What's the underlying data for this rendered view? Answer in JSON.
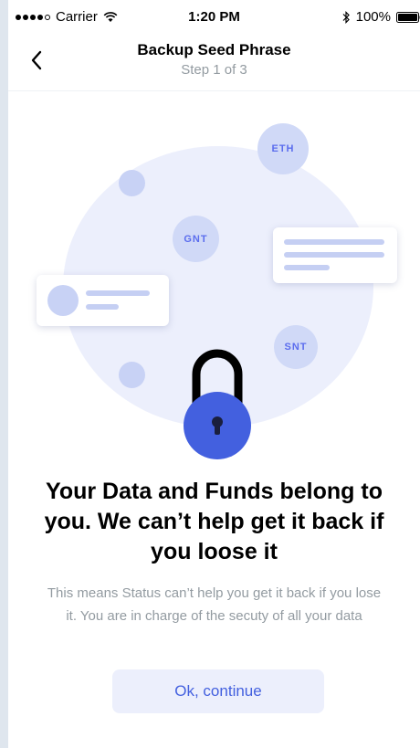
{
  "status_bar": {
    "carrier": "Carrier",
    "time": "1:20 PM",
    "battery_percent": "100%"
  },
  "header": {
    "title": "Backup Seed Phrase",
    "subtitle": "Step 1 of 3",
    "back_icon": "chevron-left-icon"
  },
  "illustration": {
    "tokens": [
      "ETH",
      "GNT",
      "SNT"
    ],
    "lock_icon": "padlock-icon",
    "colors": {
      "circle": "#eceffc",
      "token": "#d0d9f7",
      "token_text": "#5b6dee",
      "lock_body": "#4360df"
    }
  },
  "content": {
    "heading": "Your Data and Funds belong to you. We can’t help get it back if you loose it",
    "description": "This means Status can’t help you get it back if you lose it. You are in charge of the secuty of all your data"
  },
  "actions": {
    "continue_label": "Ok, continue"
  },
  "colors": {
    "accent": "#4360df",
    "muted_text": "#939ba1",
    "button_bg": "#eceffc"
  }
}
